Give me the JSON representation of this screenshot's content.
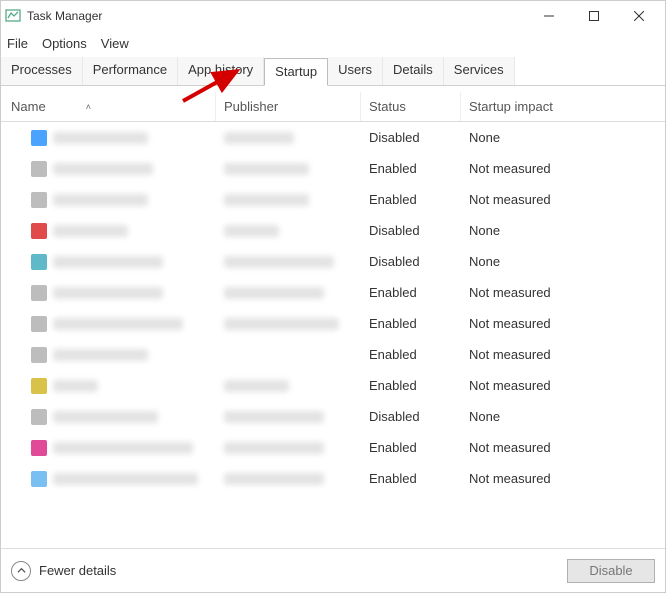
{
  "window": {
    "title": "Task Manager"
  },
  "menus": {
    "file": "File",
    "options": "Options",
    "view": "View"
  },
  "tabs": {
    "processes": "Processes",
    "performance": "Performance",
    "app_history": "App history",
    "startup": "Startup",
    "users": "Users",
    "details": "Details",
    "services": "Services"
  },
  "columns": {
    "name": "Name",
    "publisher": "Publisher",
    "status": "Status",
    "impact": "Startup impact"
  },
  "status_values": {
    "enabled": "Enabled",
    "disabled": "Disabled"
  },
  "impact_values": {
    "none": "None",
    "not_measured": "Not measured"
  },
  "rows": [
    {
      "icon_color": "c-blue",
      "name_w": 95,
      "pub_w": 70,
      "status": "Disabled",
      "impact": "None"
    },
    {
      "icon_color": "c-gray",
      "name_w": 100,
      "pub_w": 85,
      "status": "Enabled",
      "impact": "Not measured"
    },
    {
      "icon_color": "c-gray",
      "name_w": 95,
      "pub_w": 85,
      "status": "Enabled",
      "impact": "Not measured"
    },
    {
      "icon_color": "c-red",
      "name_w": 75,
      "pub_w": 55,
      "status": "Disabled",
      "impact": "None"
    },
    {
      "icon_color": "c-teal",
      "name_w": 110,
      "pub_w": 110,
      "status": "Disabled",
      "impact": "None"
    },
    {
      "icon_color": "c-gray",
      "name_w": 110,
      "pub_w": 100,
      "status": "Enabled",
      "impact": "Not measured"
    },
    {
      "icon_color": "c-gray",
      "name_w": 130,
      "pub_w": 115,
      "status": "Enabled",
      "impact": "Not measured"
    },
    {
      "icon_color": "c-gray",
      "name_w": 95,
      "pub_w": 0,
      "status": "Enabled",
      "impact": "Not measured"
    },
    {
      "icon_color": "c-yellow",
      "name_w": 45,
      "pub_w": 65,
      "status": "Enabled",
      "impact": "Not measured"
    },
    {
      "icon_color": "c-gray",
      "name_w": 105,
      "pub_w": 100,
      "status": "Disabled",
      "impact": "None"
    },
    {
      "icon_color": "c-magenta",
      "name_w": 140,
      "pub_w": 100,
      "status": "Enabled",
      "impact": "Not measured"
    },
    {
      "icon_color": "c-sky",
      "name_w": 145,
      "pub_w": 100,
      "status": "Enabled",
      "impact": "Not measured"
    }
  ],
  "footer": {
    "fewer_details": "Fewer details",
    "disable": "Disable"
  }
}
